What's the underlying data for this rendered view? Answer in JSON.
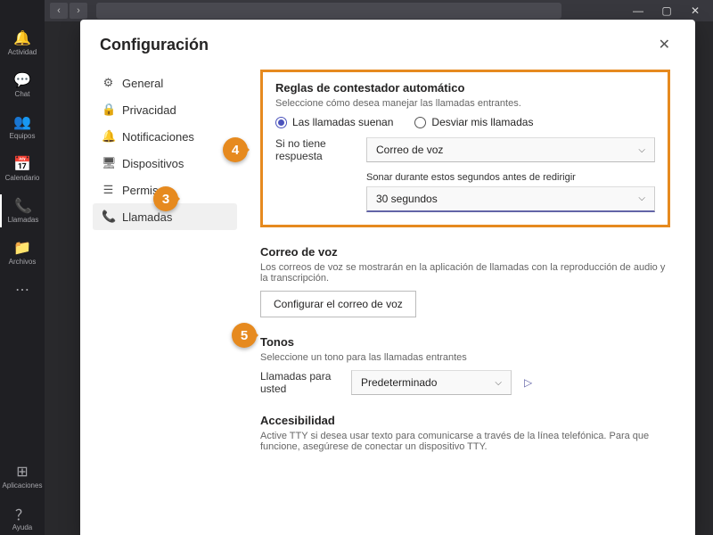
{
  "rail": {
    "items": [
      {
        "icon": "🔔",
        "label": "Actividad"
      },
      {
        "icon": "💬",
        "label": "Chat"
      },
      {
        "icon": "👥",
        "label": "Equipos"
      },
      {
        "icon": "📅",
        "label": "Calendario"
      },
      {
        "icon": "📞",
        "label": "Llamadas"
      },
      {
        "icon": "📁",
        "label": "Archivos"
      },
      {
        "icon": "⋯",
        "label": ""
      }
    ],
    "bottom": [
      {
        "icon": "⊞",
        "label": "Aplicaciones"
      },
      {
        "icon": "？",
        "label": "Ayuda"
      }
    ]
  },
  "modal": {
    "title": "Configuración",
    "nav": [
      {
        "icon": "⚙",
        "label": "General"
      },
      {
        "icon": "🔒",
        "label": "Privacidad"
      },
      {
        "icon": "🔔",
        "label": "Notificaciones"
      },
      {
        "icon": "🖥",
        "label": "Dispositivos"
      },
      {
        "icon": "☰",
        "label": "Permisos"
      },
      {
        "icon": "📞",
        "label": "Llamadas"
      }
    ],
    "rules": {
      "title": "Reglas de contestador automático",
      "sub": "Seleccione cómo desea manejar las llamadas entrantes.",
      "opt_ring": "Las llamadas suenan",
      "opt_forward": "Desviar mis llamadas",
      "unanswered_label": "Si no tiene respuesta",
      "unanswered_value": "Correo de voz",
      "ring_label": "Sonar durante estos segundos antes de redirigir",
      "ring_value": "30 segundos"
    },
    "voicemail": {
      "title": "Correo de voz",
      "sub": "Los correos de voz se mostrarán en la aplicación de llamadas con la reproducción de audio y la transcripción.",
      "button": "Configurar el correo de voz"
    },
    "ringtones": {
      "title": "Tonos",
      "sub": "Seleccione un tono para las llamadas entrantes",
      "calls_label": "Llamadas para usted",
      "calls_value": "Predeterminado"
    },
    "accessibility": {
      "title": "Accesibilidad",
      "sub": "Active TTY si desea usar texto para comunicarse a través de la línea telefónica. Para que funcione, asegúrese de conectar un dispositivo TTY."
    }
  },
  "callouts": {
    "c3": "3",
    "c4": "4",
    "c5": "5"
  }
}
